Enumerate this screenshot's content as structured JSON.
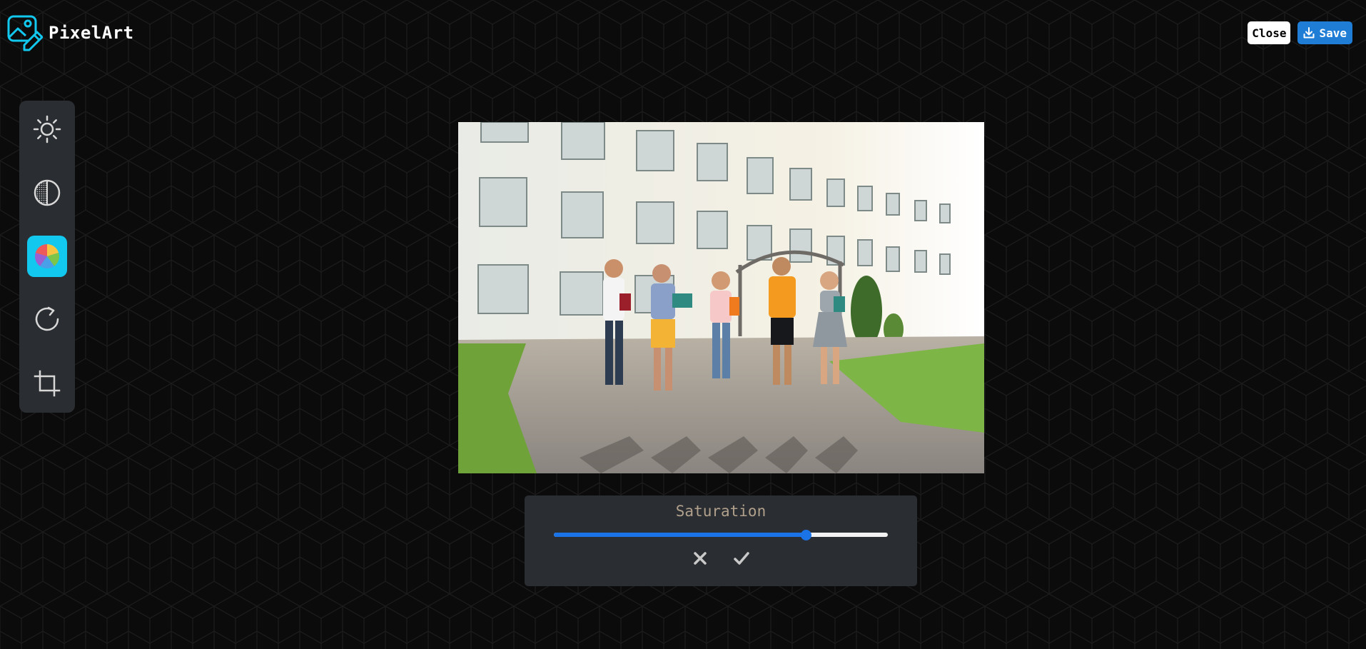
{
  "app": {
    "name": "PixelArt",
    "logo_icon": "image-edit-icon",
    "brand_color": "#12c8ef"
  },
  "header": {
    "close_label": "Close",
    "save_label": "Save",
    "save_icon": "download-icon",
    "save_color": "#1f7dd6"
  },
  "toolbar": {
    "items": [
      {
        "name": "brightness",
        "icon": "sun-icon",
        "active": false
      },
      {
        "name": "contrast",
        "icon": "contrast-icon",
        "active": false
      },
      {
        "name": "saturation",
        "icon": "color-wheel-icon",
        "active": true
      },
      {
        "name": "rotate",
        "icon": "rotate-icon",
        "active": false
      },
      {
        "name": "crop",
        "icon": "crop-icon",
        "active": false
      }
    ],
    "active_color": "#12c8ef"
  },
  "canvas": {
    "content": "photo"
  },
  "adjust_panel": {
    "label": "Saturation",
    "value_fraction": 0.755,
    "slider_color": "#1b73e8",
    "cancel_icon": "close-icon",
    "confirm_icon": "check-icon"
  }
}
